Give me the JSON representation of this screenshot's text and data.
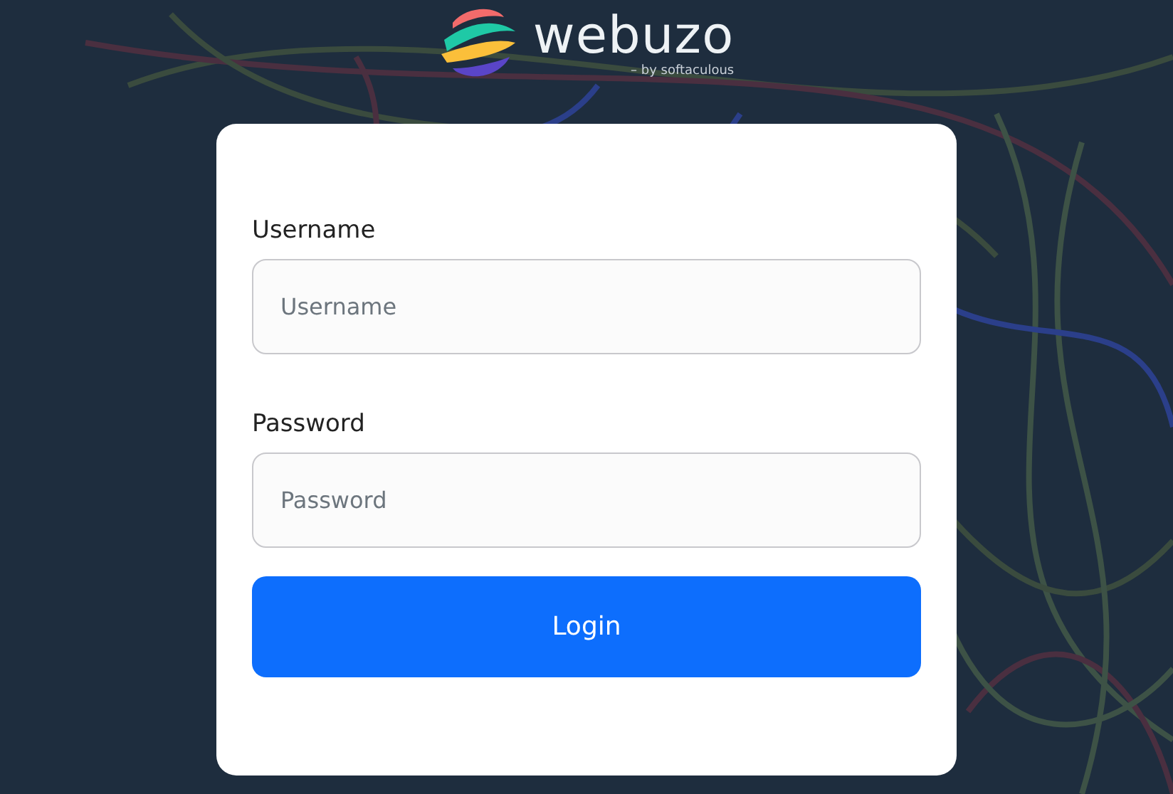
{
  "logo": {
    "name": "webuzo",
    "tagline": "– by softaculous"
  },
  "form": {
    "fields": [
      {
        "label": "Username",
        "placeholder": "Username"
      },
      {
        "label": "Password",
        "placeholder": "Password"
      }
    ],
    "submit": "Login"
  }
}
